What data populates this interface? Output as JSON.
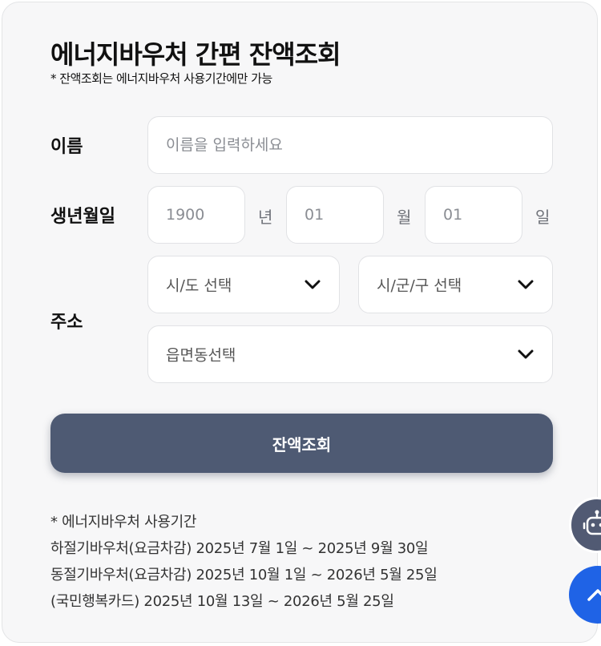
{
  "header": {
    "title": "에너지바우처 간편 잔액조회",
    "subtitle": "* 잔액조회는 에너지바우처 사용기간에만 가능"
  },
  "form": {
    "name": {
      "label": "이름",
      "placeholder": "이름을 입력하세요"
    },
    "birth": {
      "label": "생년월일",
      "year_placeholder": "1900",
      "year_unit": "년",
      "month_placeholder": "01",
      "month_unit": "월",
      "day_placeholder": "01",
      "day_unit": "일"
    },
    "address": {
      "label": "주소",
      "sido_selected": "시/도 선택",
      "sigungu_selected": "시/군/구 선택",
      "eupmyeondong_selected": "읍면동선택"
    },
    "submit_label": "잔액조회"
  },
  "notes": {
    "heading": "* 에너지바우처 사용기간",
    "lines": [
      "하절기바우처(요금차감) 2025년 7월 1일 ~ 2025년 9월 30일",
      "동절기바우처(요금차감) 2025년 10월 1일 ~ 2026년 5월 25일",
      "(국민행복카드) 2025년 10월 13일 ~ 2026년 5월 25일"
    ]
  },
  "floating": {
    "chatbot_icon": "robot-icon",
    "scroll_top_icon": "chevron-up-icon"
  },
  "colors": {
    "submit_bg": "#4e5a73",
    "chatbot_bg": "#515a73",
    "scroll_top_bg": "#1f63e6",
    "card_bg": "#f7f7f8"
  }
}
